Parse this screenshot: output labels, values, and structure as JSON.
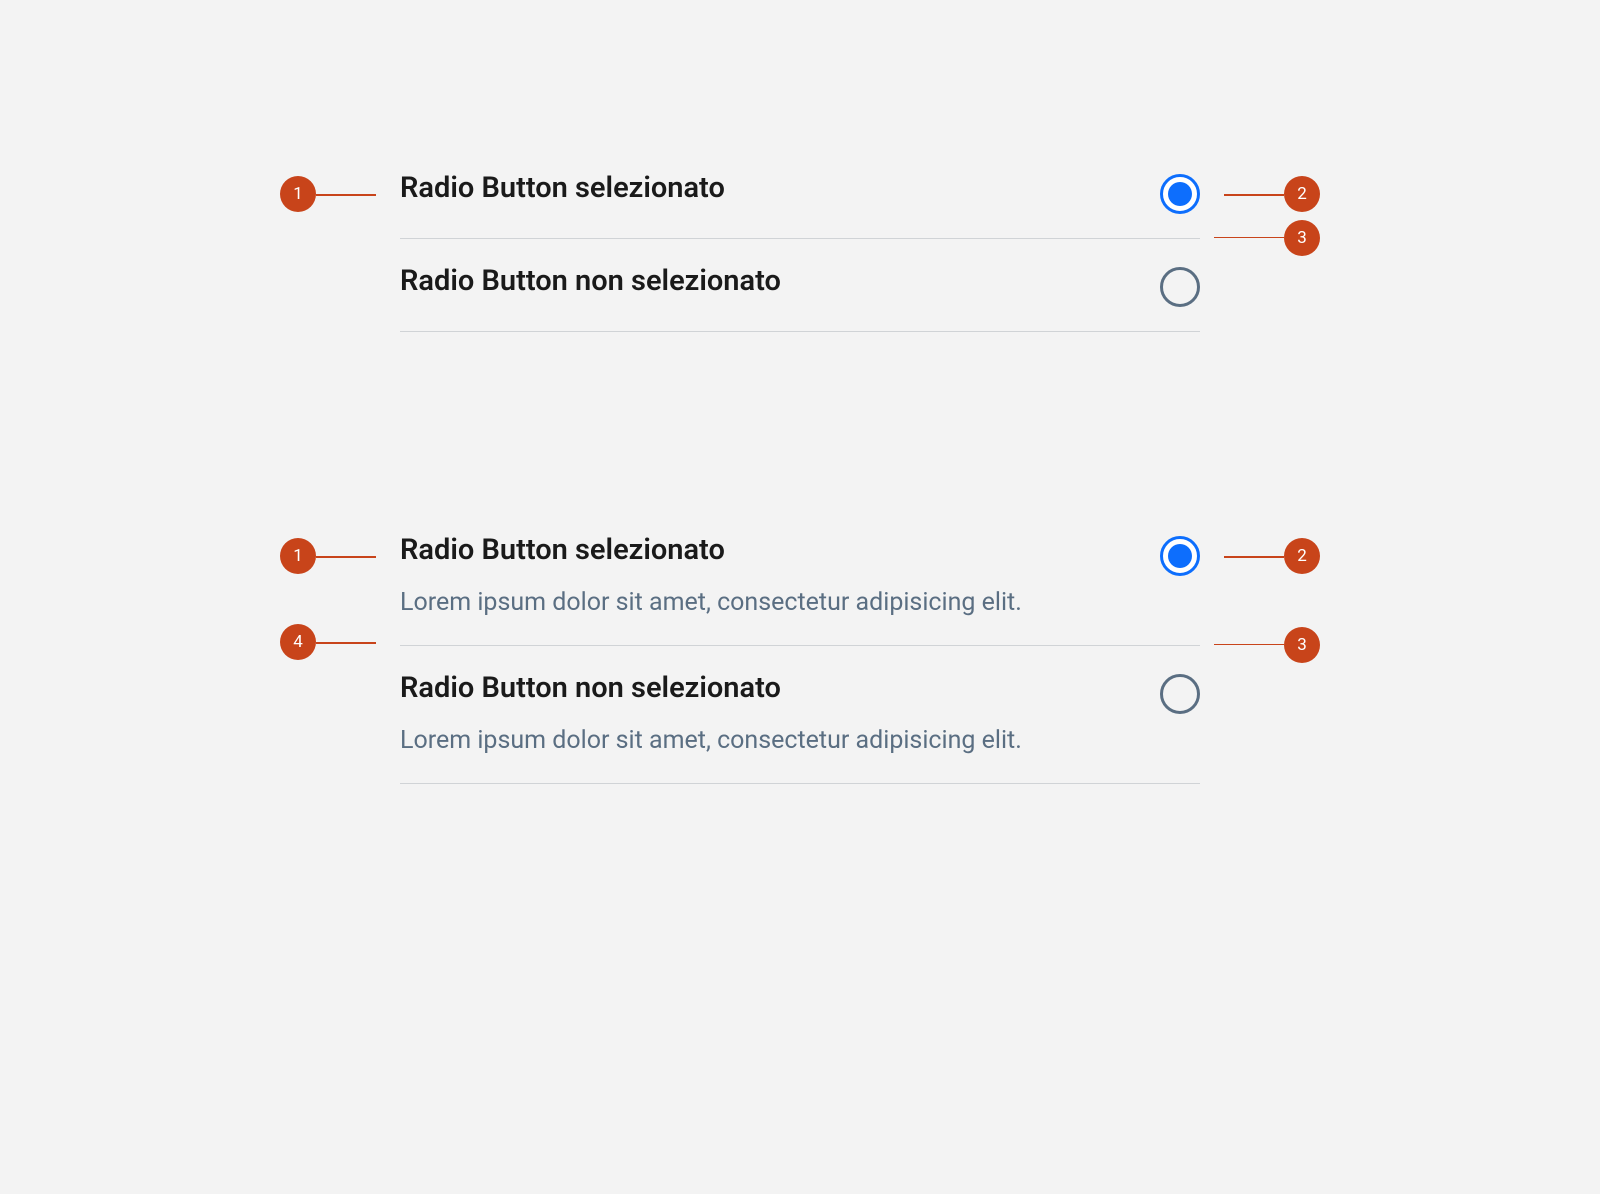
{
  "annotations": {
    "b1": "1",
    "b2": "2",
    "b3": "3",
    "b4": "4"
  },
  "group_a": {
    "row1": {
      "label": "Radio Button selezionato"
    },
    "row2": {
      "label": "Radio Button non selezionato"
    }
  },
  "group_b": {
    "row1": {
      "label": "Radio Button selezionato",
      "desc": "Lorem ipsum dolor sit amet, consectetur adipisicing elit."
    },
    "row2": {
      "label": "Radio Button non selezionato",
      "desc": "Lorem ipsum dolor sit amet, consectetur adipisicing elit."
    }
  }
}
